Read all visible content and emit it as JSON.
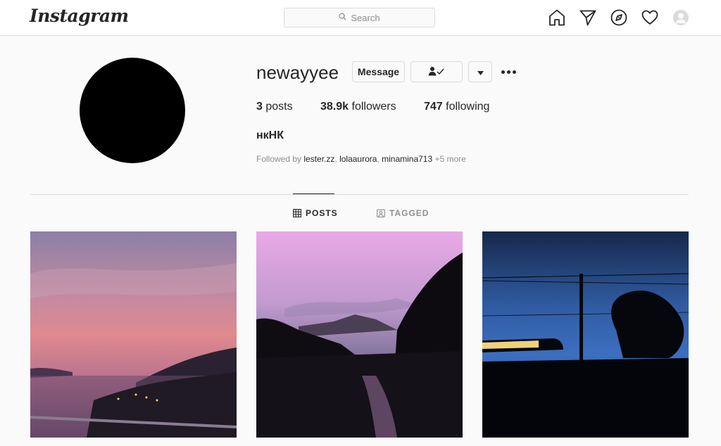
{
  "header": {
    "logo_text": "Instagram",
    "search_placeholder": "Search",
    "icons": [
      "home-icon",
      "direct-icon",
      "explore-icon",
      "activity-icon",
      "profile-avatar"
    ]
  },
  "profile": {
    "username": "newayyee",
    "buttons": {
      "message": "Message",
      "following_icon": "person-check-icon",
      "dropdown_icon": "caret-down-icon",
      "options_icon": "more-options-icon"
    },
    "stats": {
      "posts_count": "3",
      "posts_label": "posts",
      "followers_count": "38.9k",
      "followers_label": "followers",
      "following_count": "747",
      "following_label": "following"
    },
    "full_name": "нкНК",
    "followed_by": {
      "prefix": "Followed by",
      "accounts": [
        "lester.zz",
        "lolaaurora",
        "minamina713"
      ],
      "more": "+5 more"
    }
  },
  "tabs": [
    {
      "label": "POSTS",
      "icon": "grid-icon",
      "active": true
    },
    {
      "label": "TAGGED",
      "icon": "tagged-icon",
      "active": false
    }
  ],
  "posts": [
    {
      "description": "sunset-over-bay"
    },
    {
      "description": "dusk-river-trees"
    },
    {
      "description": "night-sky-powerline"
    }
  ],
  "colors": {
    "text_primary": "#262626",
    "text_secondary": "#8e8e8e",
    "border": "#dbdbdb",
    "background": "#fafafa"
  }
}
